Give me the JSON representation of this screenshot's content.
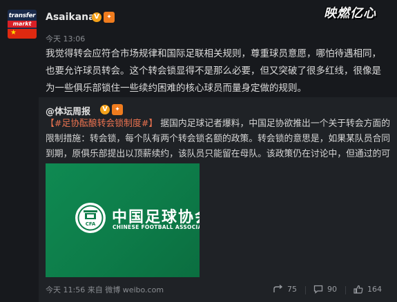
{
  "post": {
    "avatar": {
      "logo_top": "transfer",
      "logo_bottom": "markt"
    },
    "username": "Asaikana",
    "verified_badge": "V",
    "timestamp": "今天 13:06",
    "brand_logo": "映燃亿心",
    "text": "我觉得转会应符合市场规律和国际足联相关规则，尊重球员意愿，哪怕待遇相同，也要允许球员转会。这个转会锁显得不是那么必要，但又突破了很多红线，很像是为一些俱乐部锁住一些续约困难的核心球员而量身定做的规则。"
  },
  "repost": {
    "author": "@体坛周报",
    "verified_badge": "V",
    "hashtag": "【#足协酝酿转会锁制度#】",
    "text": "据国内足球记者爆料，中国足协欲推出一个关于转会方面的限制措施：转会锁，每个队有两个转会锁名额的政策。转会锁的意思是，如果某队员合同到期，原俱乐部提出以顶薪续约，该队员只能留在母队。该政策仍在讨论中，但通过的可能性很大。",
    "image": {
      "title_cn": "中国足球协会",
      "title_en": "CHINESE FOOTBALL ASSOCIATION",
      "emblem_text": "CFA"
    },
    "footer": {
      "time": "今天 11:56",
      "via_label": "来自",
      "source": "微博 weibo.com"
    },
    "actions": {
      "repost_count": "75",
      "comment_count": "90",
      "like_count": "164"
    }
  },
  "colors": {
    "background": "#17191d",
    "repost_background": "#1f2226",
    "hashtag": "#eb7350",
    "badge": "#f4a21b",
    "cfa_green": "#0d7c49"
  }
}
